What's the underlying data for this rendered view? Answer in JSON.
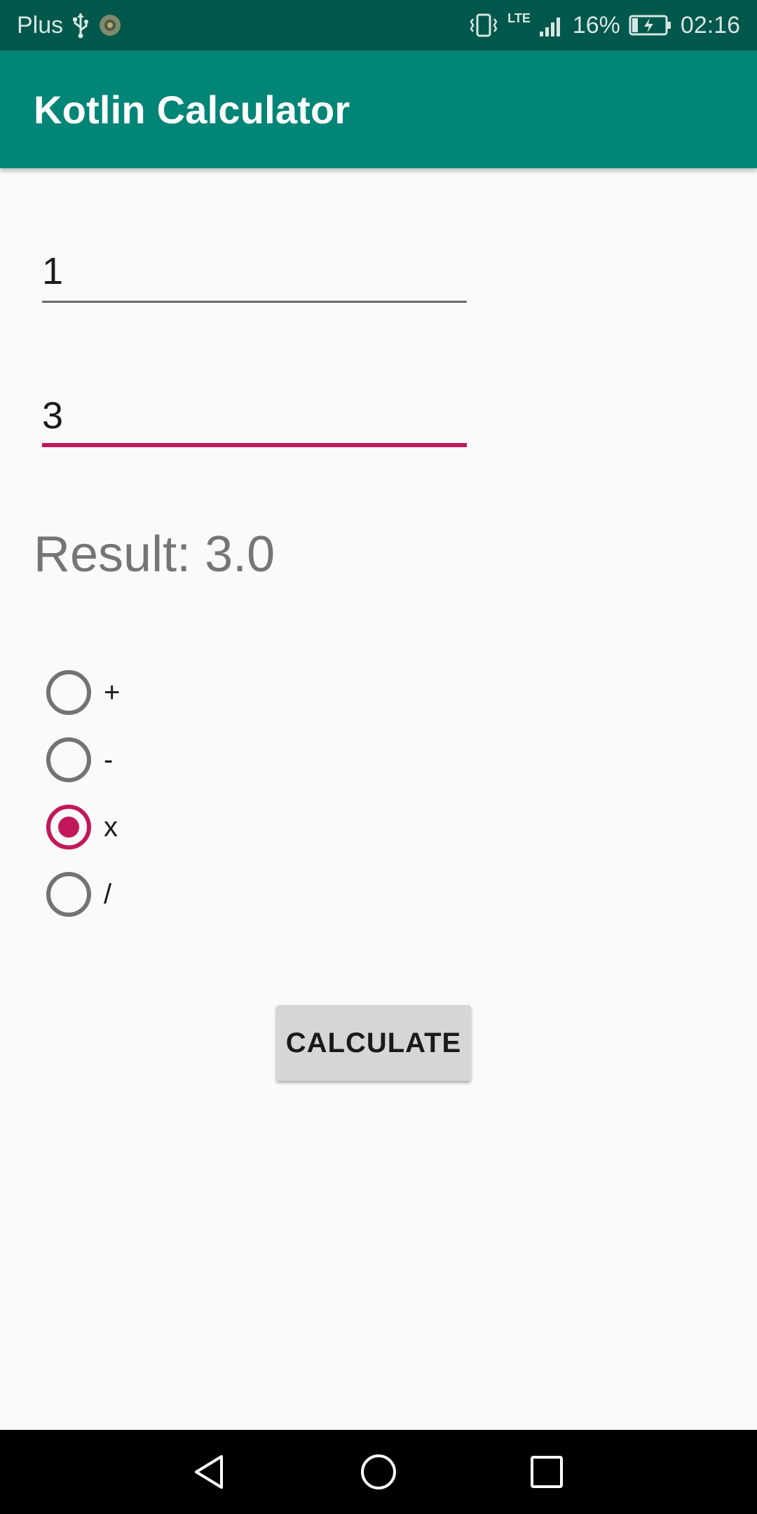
{
  "status_bar": {
    "carrier": "Plus",
    "network": "LTE",
    "battery_percent": "16%",
    "time": "02:16"
  },
  "app_bar": {
    "title": "Kotlin Calculator"
  },
  "form": {
    "first_number": "1",
    "second_number": "3",
    "result_text": "Result: 3.0"
  },
  "operations": [
    {
      "label": "+",
      "checked": false
    },
    {
      "label": "-",
      "checked": false
    },
    {
      "label": "x",
      "checked": true
    },
    {
      "label": "/",
      "checked": false
    }
  ],
  "calculate_button": {
    "label": "CALCULATE"
  },
  "colors": {
    "primary": "#008577",
    "primary_dark": "#00574b",
    "accent": "#c2185b"
  },
  "icons": {
    "usb": "usb-icon",
    "app_notification": "app-notification-icon",
    "vibrate": "vibrate-icon",
    "signal": "signal-icon",
    "battery": "battery-charging-icon",
    "back": "back-icon",
    "home": "home-icon",
    "recent": "recent-apps-icon"
  }
}
